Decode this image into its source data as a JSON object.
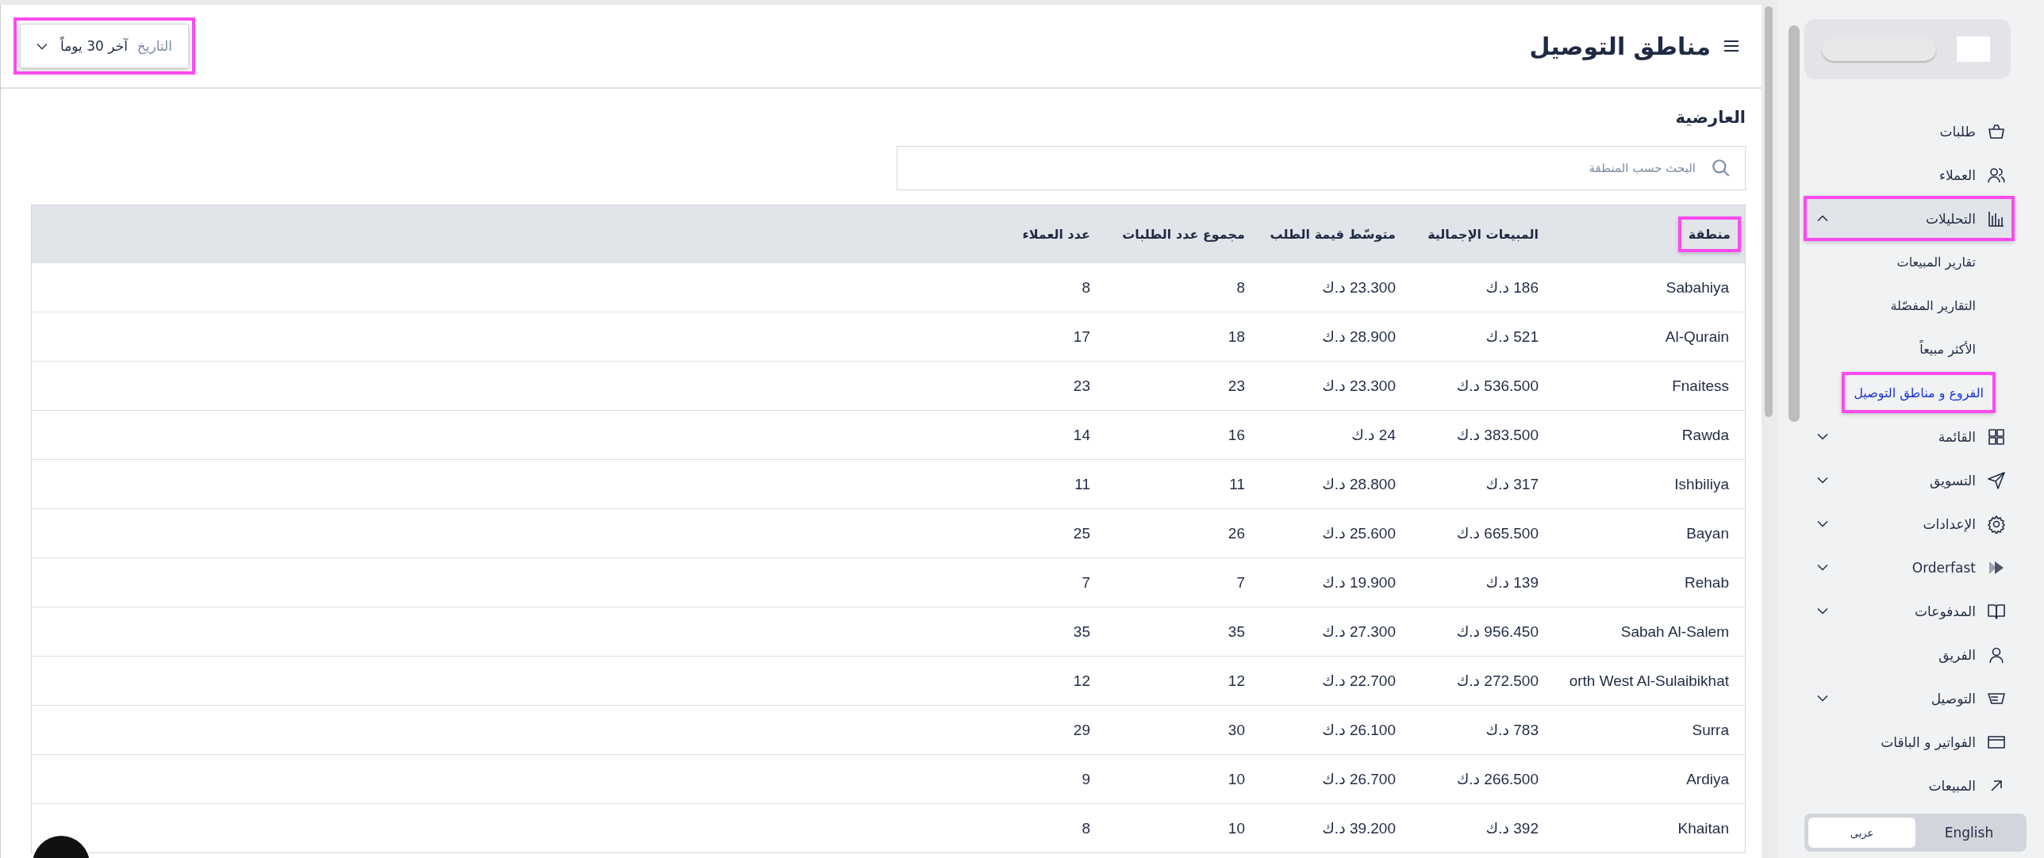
{
  "header": {
    "title": "مناطق التوصيل",
    "date_filter": {
      "label": "التاريخ",
      "value": "آخر 30 يوماً",
      "highlighted": true
    }
  },
  "section_title": "العارضية",
  "search": {
    "placeholder": "البحث حسب المنطقة"
  },
  "table": {
    "columns": [
      {
        "label": "منطقة",
        "highlighted": true
      },
      {
        "label": "المبيعات الإجمالية",
        "highlighted": false
      },
      {
        "label": "متوسّط قيمة الطلب",
        "highlighted": false
      },
      {
        "label": "مجموع عدد الطلبات",
        "highlighted": false
      },
      {
        "label": "عدد العملاء",
        "highlighted": false
      }
    ],
    "rows": [
      [
        "Sabahiya",
        "186 د.ك",
        "23.300 د.ك",
        "8",
        "8"
      ],
      [
        "Al-Qurain",
        "521 د.ك",
        "28.900 د.ك",
        "18",
        "17"
      ],
      [
        "Fnaitess",
        "536.500 د.ك",
        "23.300 د.ك",
        "23",
        "23"
      ],
      [
        "Rawda",
        "383.500 د.ك",
        "24 د.ك",
        "16",
        "14"
      ],
      [
        "Ishbiliya",
        "317 د.ك",
        "28.800 د.ك",
        "11",
        "11"
      ],
      [
        "Bayan",
        "665.500 د.ك",
        "25.600 د.ك",
        "26",
        "25"
      ],
      [
        "Rehab",
        "139 د.ك",
        "19.900 د.ك",
        "7",
        "7"
      ],
      [
        "Sabah Al-Salem",
        "956.450 د.ك",
        "27.300 د.ك",
        "35",
        "35"
      ],
      [
        "orth West Al-Sulaibikhat",
        "272.500 د.ك",
        "22.700 د.ك",
        "12",
        "12"
      ],
      [
        "Surra",
        "783 د.ك",
        "26.100 د.ك",
        "30",
        "29"
      ],
      [
        "Ardiya",
        "266.500 د.ك",
        "26.700 د.ك",
        "10",
        "9"
      ],
      [
        "Khaitan",
        "392 د.ك",
        "39.200 د.ك",
        "10",
        "8"
      ]
    ]
  },
  "sidebar": {
    "items": [
      {
        "label": "طلبات",
        "kind": "link",
        "highlighted": false
      },
      {
        "label": "العملاء",
        "kind": "link",
        "highlighted": false
      },
      {
        "label": "التحليلات",
        "kind": "group",
        "expanded": true,
        "highlighted": true,
        "children": [
          {
            "label": "تقارير المبيعات",
            "selected": false,
            "highlighted": false
          },
          {
            "label": "التقارير المفصّلة",
            "selected": false,
            "highlighted": false
          },
          {
            "label": "الأكثر مبيعاً",
            "selected": false,
            "highlighted": false
          },
          {
            "label": "الفروع و مناطق التوصيل",
            "selected": true,
            "highlighted": true
          }
        ]
      },
      {
        "label": "القائمة",
        "kind": "group",
        "expanded": false,
        "highlighted": false
      },
      {
        "label": "التسويق",
        "kind": "group",
        "expanded": false,
        "highlighted": false
      },
      {
        "label": "الإعدادات",
        "kind": "group",
        "expanded": false,
        "highlighted": false
      },
      {
        "label": "Orderfast",
        "kind": "group",
        "expanded": false,
        "highlighted": false
      },
      {
        "label": "المدفوعات",
        "kind": "group",
        "expanded": false,
        "highlighted": false
      },
      {
        "label": "الفريق",
        "kind": "link",
        "highlighted": false
      },
      {
        "label": "التوصيل",
        "kind": "group",
        "expanded": false,
        "highlighted": false
      },
      {
        "label": "الفواتير و الباقات",
        "kind": "link",
        "highlighted": false
      },
      {
        "label": "المبيعات",
        "kind": "link",
        "highlighted": false
      }
    ],
    "languages": [
      {
        "label": "English",
        "selected": false
      },
      {
        "label": "عربى",
        "selected": true
      }
    ]
  }
}
